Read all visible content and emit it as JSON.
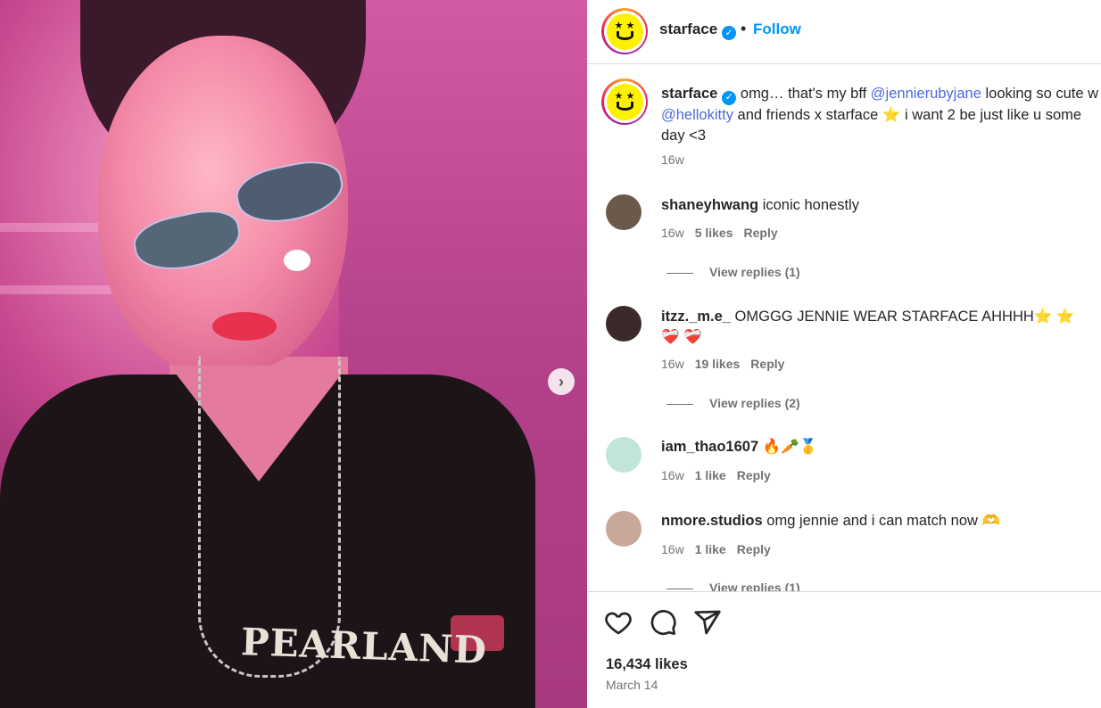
{
  "post": {
    "author": "starface",
    "follow_label": "Follow",
    "separator": "•",
    "verified_mark": "✓",
    "next_icon": "›",
    "shirt_text": "PEARLAND"
  },
  "caption": {
    "username": "starface",
    "text_1": "omg… that's my bff ",
    "mention_1": "@jennierubyjane",
    "text_2": " looking so cute w ",
    "mention_2": "@hellokitty",
    "text_3": " and friends x starface ⭐ i want 2 be just like u some day <3",
    "time": "16w"
  },
  "comments": [
    {
      "username": "shaneyhwang",
      "text": "iconic honestly",
      "time": "16w",
      "likes": "5 likes",
      "reply": "Reply",
      "view_replies": "View replies (1)",
      "avatar_color": "#6b5a4a"
    },
    {
      "username": "itzz._m.e_",
      "text": "OMGGG JENNIE WEAR STARFACE AHHHH⭐ ⭐ ❤️‍🩹 ❤️‍🩹",
      "time": "16w",
      "likes": "19 likes",
      "reply": "Reply",
      "view_replies": "View replies (2)",
      "avatar_color": "#3b2a2a"
    },
    {
      "username": "iam_thao1607",
      "text": "🔥🥕🥇",
      "time": "16w",
      "likes": "1 like",
      "reply": "Reply",
      "view_replies": "",
      "avatar_color": "#bfe6d8"
    },
    {
      "username": "nmore.studios",
      "text": "omg jennie and i can match now 🫶",
      "time": "16w",
      "likes": "1 like",
      "reply": "Reply",
      "view_replies": "View replies (1)",
      "avatar_color": "#c9a79a"
    }
  ],
  "actions": {
    "like_icon": "heart-icon",
    "comment_icon": "comment-icon",
    "share_icon": "share-icon",
    "likes_count": "16,434 likes",
    "date": "March 14"
  },
  "colors": {
    "accent_blue": "#0095f6",
    "mention": "#4f6ad9",
    "muted": "#737373",
    "brand_yellow": "#fff200"
  }
}
